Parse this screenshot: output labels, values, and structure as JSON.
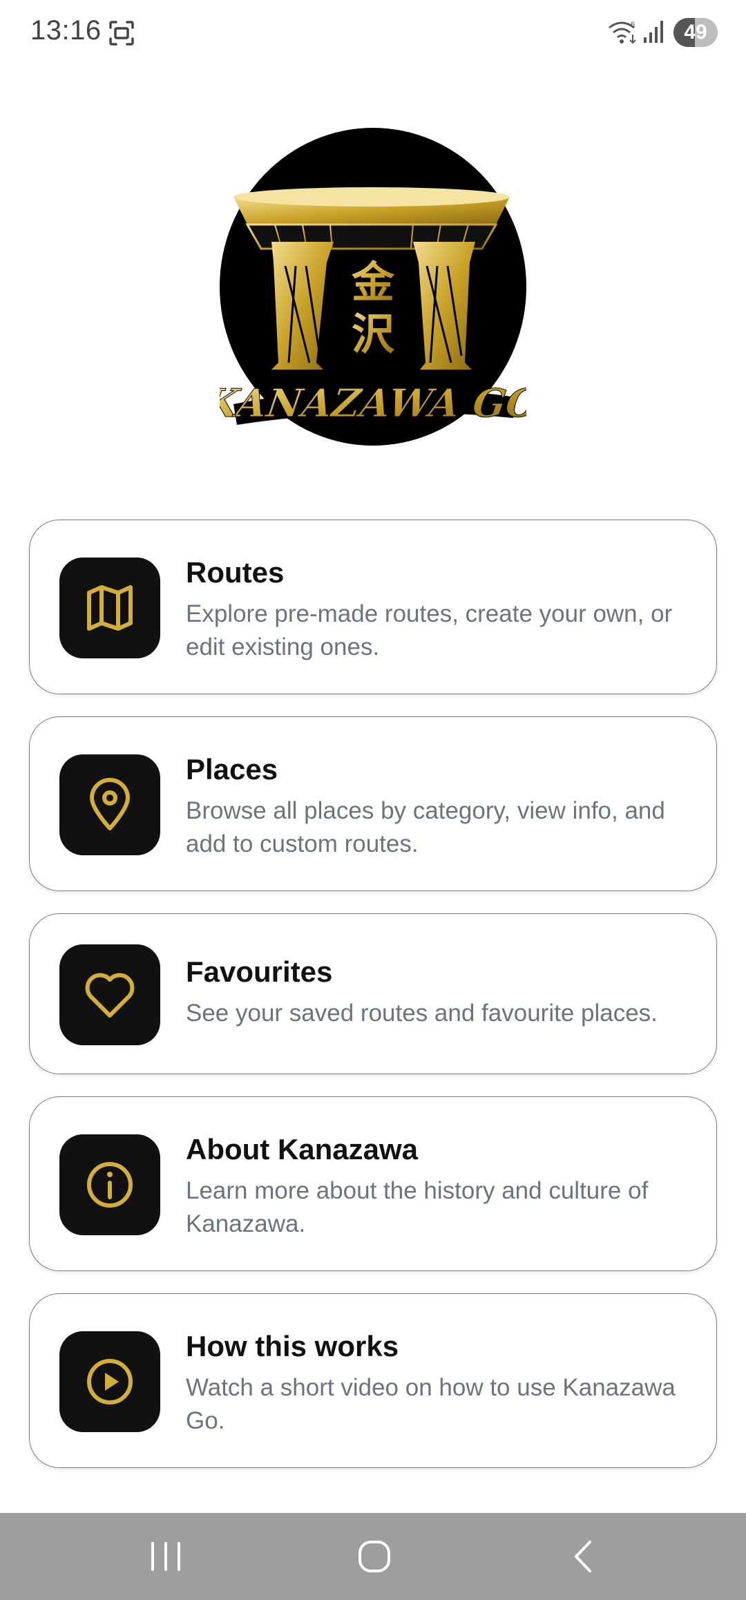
{
  "status_bar": {
    "time": "13:16",
    "battery_level": "49",
    "battery_fraction": 0.49,
    "icons": [
      "screenshot-icon",
      "wifi-icon",
      "signal-icon",
      "battery-icon"
    ]
  },
  "logo": {
    "lettering": "KANAZAWA GO",
    "kanji": "金沢",
    "colors": {
      "gold": "#C9A227",
      "background": "#000000"
    }
  },
  "menu": [
    {
      "icon": "map-icon",
      "title": "Routes",
      "description": "Explore pre-made routes, create your own, or edit existing ones."
    },
    {
      "icon": "location-pin-icon",
      "title": "Places",
      "description": "Browse all places by category, view info, and add to custom routes."
    },
    {
      "icon": "heart-icon",
      "title": "Favourites",
      "description": "See your saved routes and favourite places."
    },
    {
      "icon": "info-icon",
      "title": "About Kanazawa",
      "description": "Learn more about the history and culture of Kanazawa."
    },
    {
      "icon": "play-circle-icon",
      "title": "How this works",
      "description": "Watch a short video on how to use Kanazawa Go."
    }
  ],
  "theme": {
    "accent": "#D4AF37",
    "icon_background": "#111111",
    "card_border": "#7A7A7A",
    "description_text": "#6B7280"
  },
  "nav_bar": {
    "buttons": [
      "recents-button",
      "home-button",
      "back-button"
    ]
  }
}
